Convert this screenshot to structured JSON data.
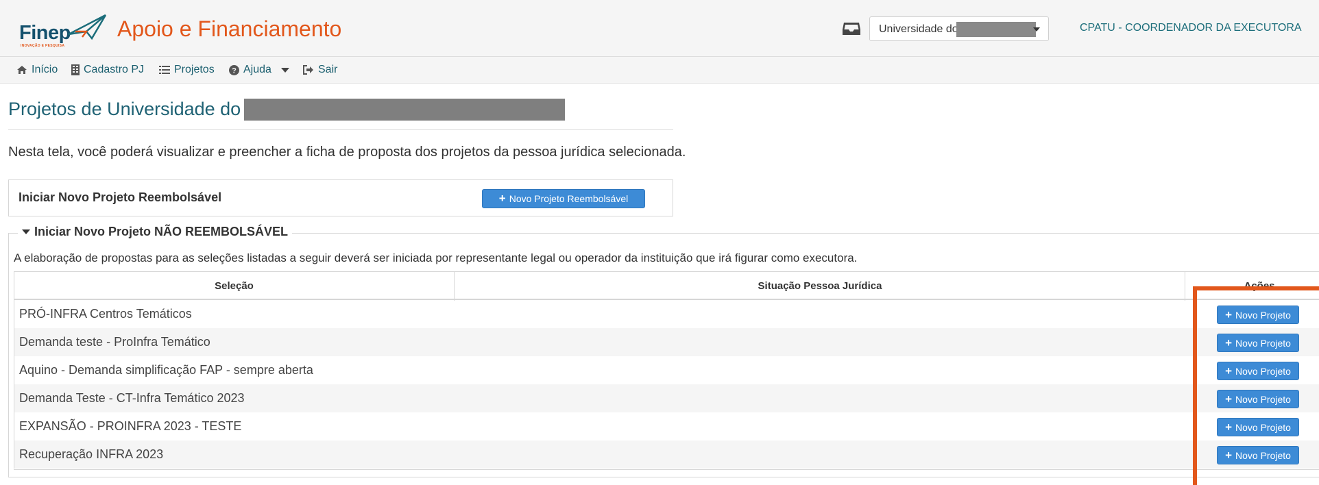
{
  "header": {
    "logo_text": "Finep",
    "logo_subtext": "INOVAÇÃO E PESQUISA",
    "app_title": "Apoio e Financiamento",
    "unit_select_value": "Universidade do",
    "user_role": "CPATU - COORDENADOR DA EXECUTORA"
  },
  "nav": {
    "items": [
      {
        "label": "Início",
        "icon": "home-icon"
      },
      {
        "label": "Cadastro PJ",
        "icon": "building-icon"
      },
      {
        "label": "Projetos",
        "icon": "list-icon"
      },
      {
        "label": "Ajuda",
        "icon": "question-circle-icon"
      },
      {
        "label": "Sair",
        "icon": "sign-out-icon"
      }
    ]
  },
  "page": {
    "title": "Projetos de Universidade do",
    "intro": "Nesta tela, você poderá visualizar e preencher a ficha de proposta dos projetos da pessoa jurídica selecionada."
  },
  "reembolsavel": {
    "label": "Iniciar Novo Projeto Reembolsável",
    "button": "Novo Projeto Reembolsável"
  },
  "nao_reembolsavel": {
    "legend": "Iniciar Novo Projeto NÃO REEMBOLSÁVEL",
    "note": "A elaboração de propostas para as seleções listadas a seguir deverá ser iniciada por representante legal ou operador da instituição que irá figurar como executora.",
    "columns": [
      "Seleção",
      "Situação Pessoa Jurídica",
      "Ações"
    ],
    "button_label": "Novo Projeto",
    "rows": [
      {
        "selecao": "PRÓ-INFRA Centros Temáticos",
        "situacao": ""
      },
      {
        "selecao": "Demanda teste - ProInfra Temático",
        "situacao": ""
      },
      {
        "selecao": "Aquino - Demanda simplificação FAP - sempre aberta",
        "situacao": ""
      },
      {
        "selecao": "Demanda Teste - CT-Infra Temático 2023",
        "situacao": ""
      },
      {
        "selecao": "EXPANSÃO - PROINFRA 2023 - TESTE",
        "situacao": ""
      },
      {
        "selecao": "Recuperação INFRA 2023",
        "situacao": ""
      }
    ]
  },
  "colors": {
    "brand_orange": "#e2571b",
    "brand_teal": "#1f6274",
    "button_blue": "#3d8bd6"
  }
}
